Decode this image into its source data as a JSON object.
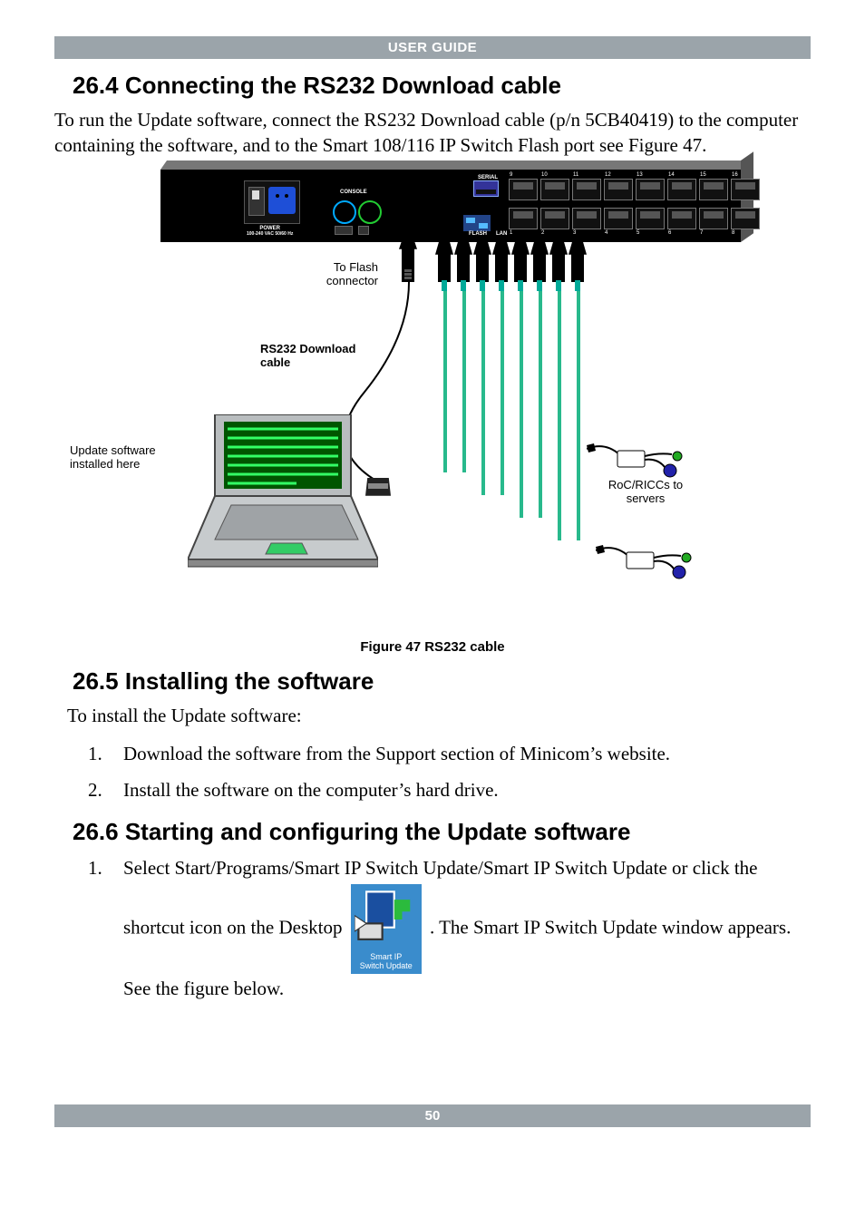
{
  "header": {
    "title": "USER GUIDE"
  },
  "section_264": {
    "heading": "26.4 Connecting the RS232 Download cable",
    "body": "To run the Update software, connect the RS232 Download cable (p/n 5CB40419) to the computer containing the software, and to the Smart 108/116 IP Switch Flash port see Figure 47."
  },
  "figure": {
    "caption": "Figure 47 RS232 cable",
    "labels": {
      "to_flash": "To Flash connector",
      "rs232_cable": "RS232 Download cable",
      "update_here": "Update software installed here",
      "ricc": "RoC/RICCs to servers"
    },
    "rack": {
      "serial": "SERIAL",
      "console": "CONSOLE",
      "power_line1": "POWER",
      "power_line2": "100-240 VAC 50/60 Hz",
      "flash": "FLASH",
      "lan": "LAN",
      "top_ports": [
        "9",
        "10",
        "11",
        "12",
        "13",
        "14",
        "15",
        "16"
      ],
      "bottom_ports": [
        "1",
        "2",
        "3",
        "4",
        "5",
        "6",
        "7",
        "8"
      ]
    }
  },
  "section_265": {
    "heading": "26.5 Installing the software",
    "intro": "To install the Update software:",
    "steps": [
      "Download the software from the Support section of Minicom’s website.",
      "Install the software on the computer’s hard drive."
    ]
  },
  "section_266": {
    "heading": "26.6 Starting and configuring the Update software",
    "step1_a": "Select Start/Programs/Smart IP Switch Update/Smart IP Switch Update or click the shortcut icon on the Desktop ",
    "step1_b": ". The Smart  IP Switch Update window appears. See the figure below.",
    "icon_line1": "Smart IP",
    "icon_line2": "Switch Update"
  },
  "footer": {
    "page_number": "50"
  }
}
